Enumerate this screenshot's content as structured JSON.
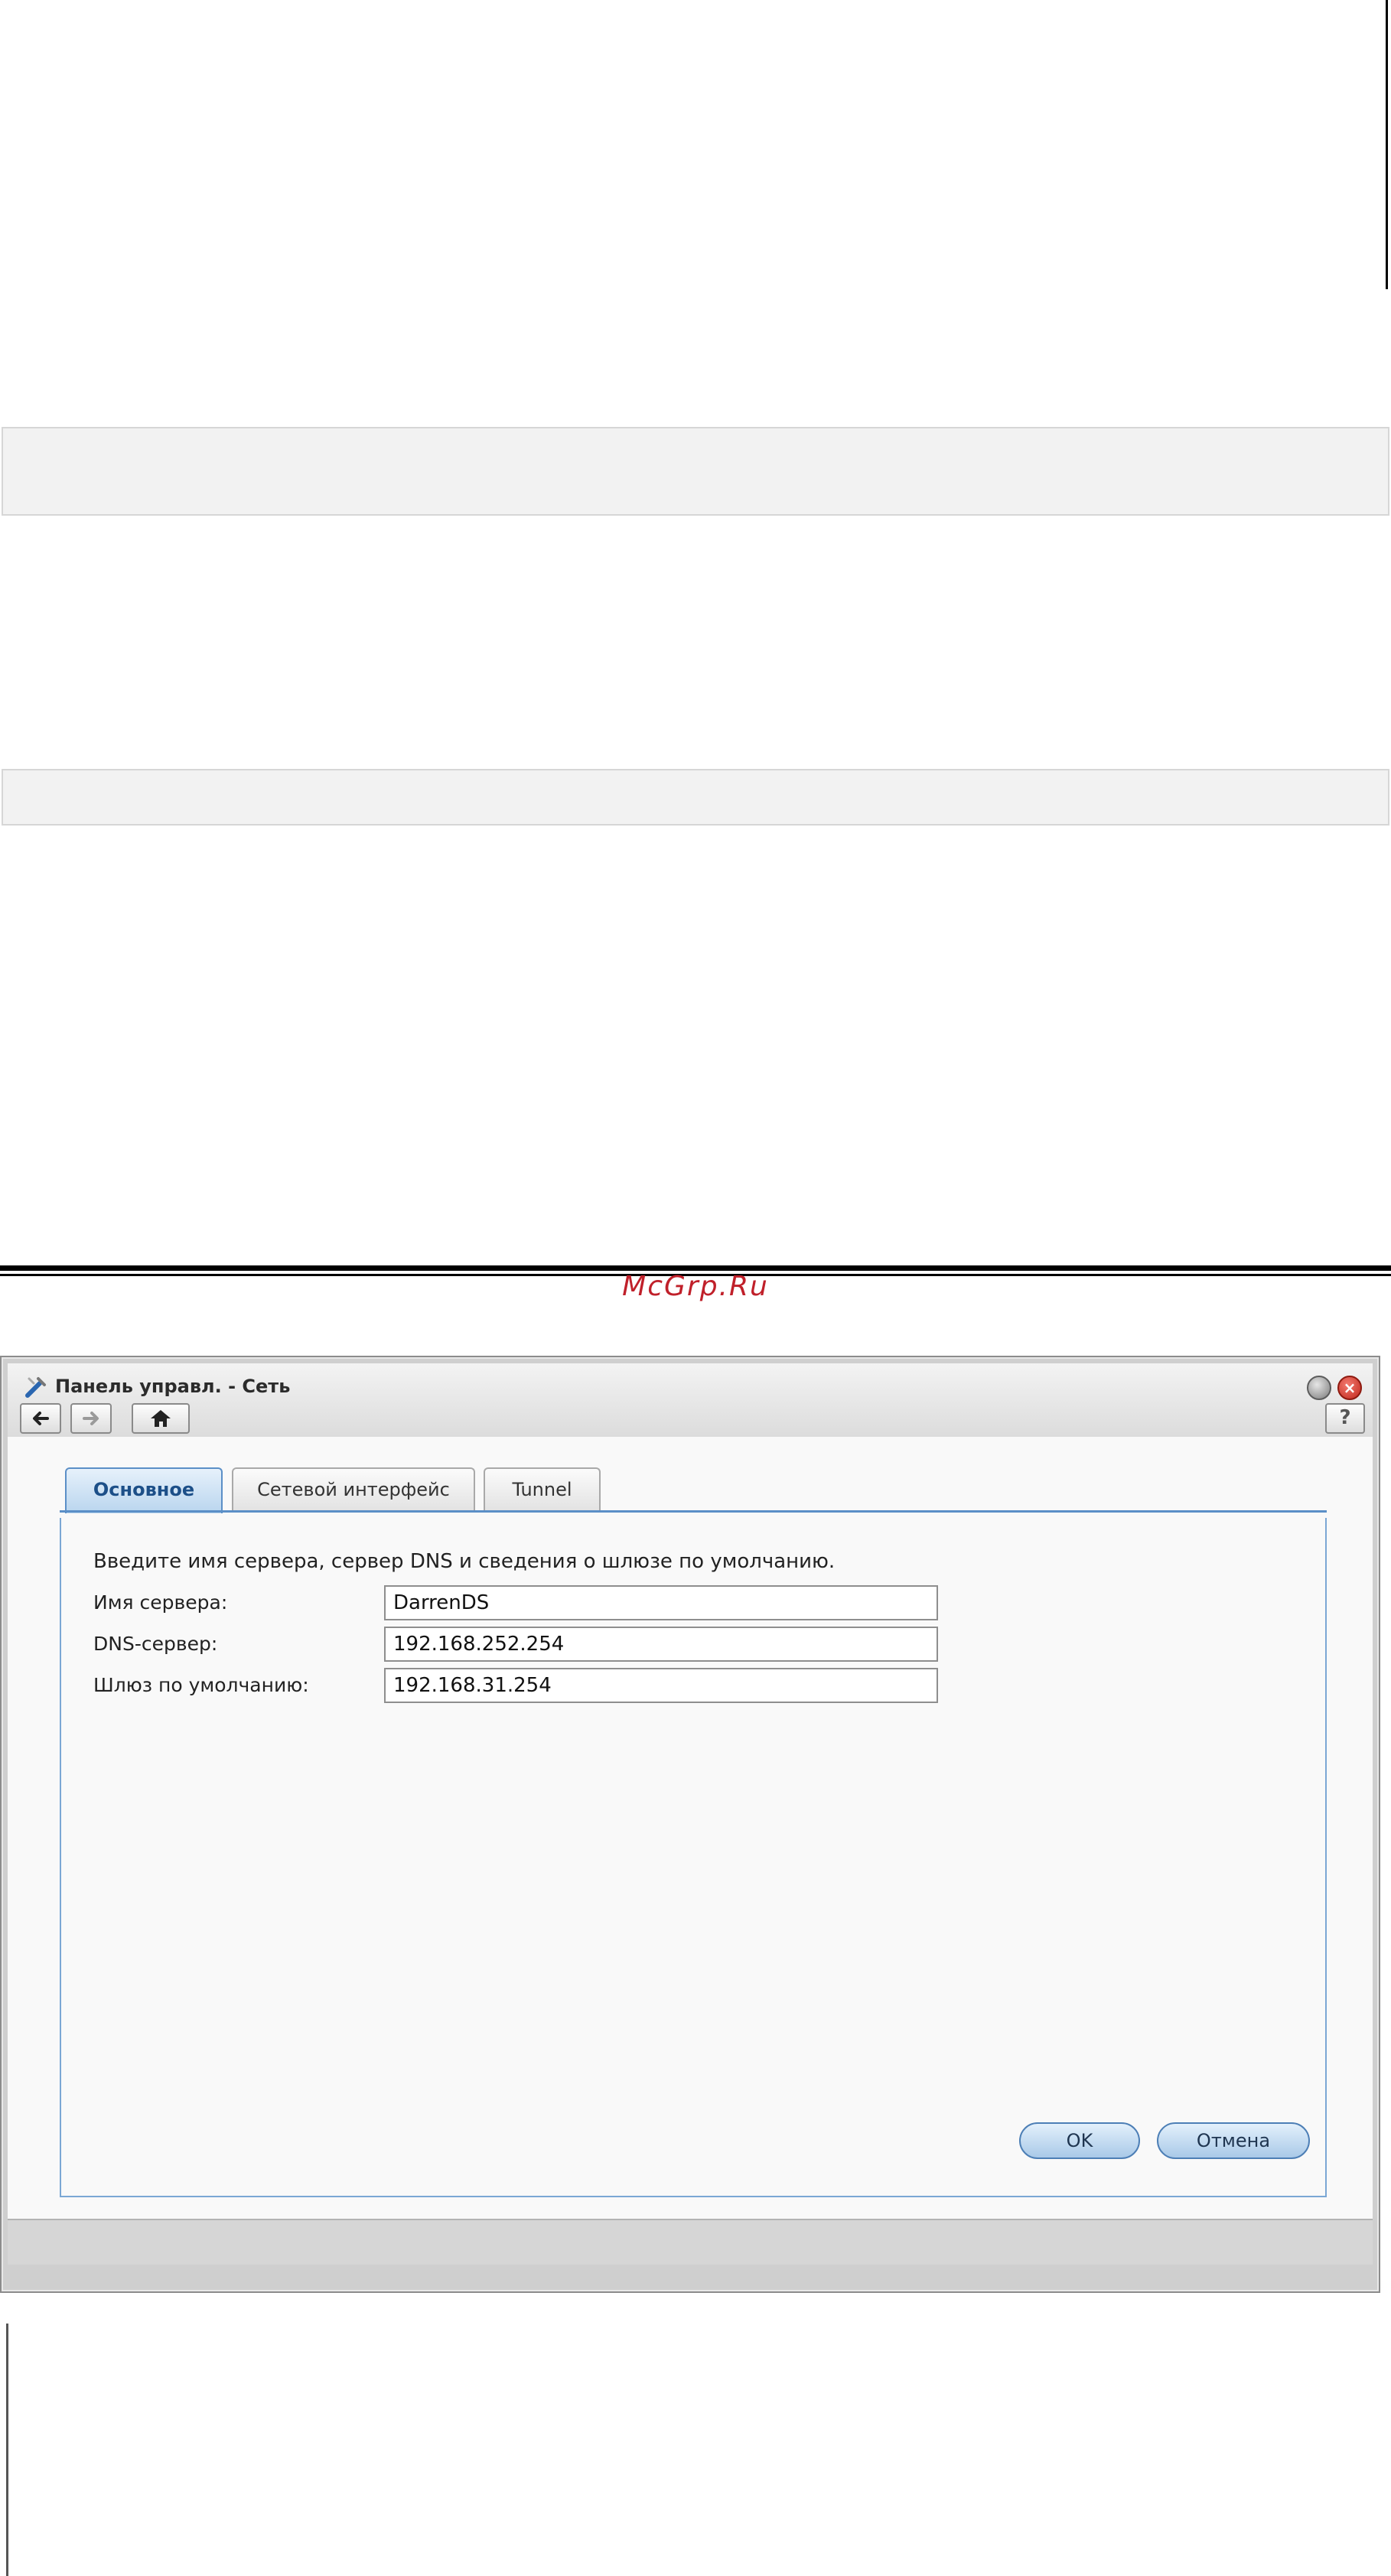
{
  "watermark": "McGrp.Ru",
  "window": {
    "title": "Панель управл. - Сеть",
    "help_label": "?",
    "close_label": "×",
    "tabs": [
      {
        "label": "Основное",
        "active": true
      },
      {
        "label": "Сетевой интерфейс",
        "active": false
      },
      {
        "label": "Tunnel",
        "active": false
      }
    ],
    "description": "Введите имя сервера, сервер DNS и сведения о шлюзе по умолчанию.",
    "fields": {
      "server_name": {
        "label": "Имя сервера:",
        "value": "DarrenDS"
      },
      "dns_server": {
        "label": "DNS-сервер:",
        "value": "192.168.252.254"
      },
      "gateway": {
        "label": "Шлюз по умолчанию:",
        "value": "192.168.31.254"
      }
    },
    "buttons": {
      "ok": "OK",
      "cancel": "Отмена"
    },
    "icons": {
      "app": "tools-icon",
      "back": "arrow-left-icon",
      "forward": "arrow-right-icon",
      "home": "home-icon",
      "minimize": "minimize-icon",
      "close": "close-icon"
    },
    "colors": {
      "accent": "#5b8fc7",
      "active_tab_text": "#1c4f88",
      "close_button": "#c0281c",
      "watermark": "#c0202a"
    }
  }
}
